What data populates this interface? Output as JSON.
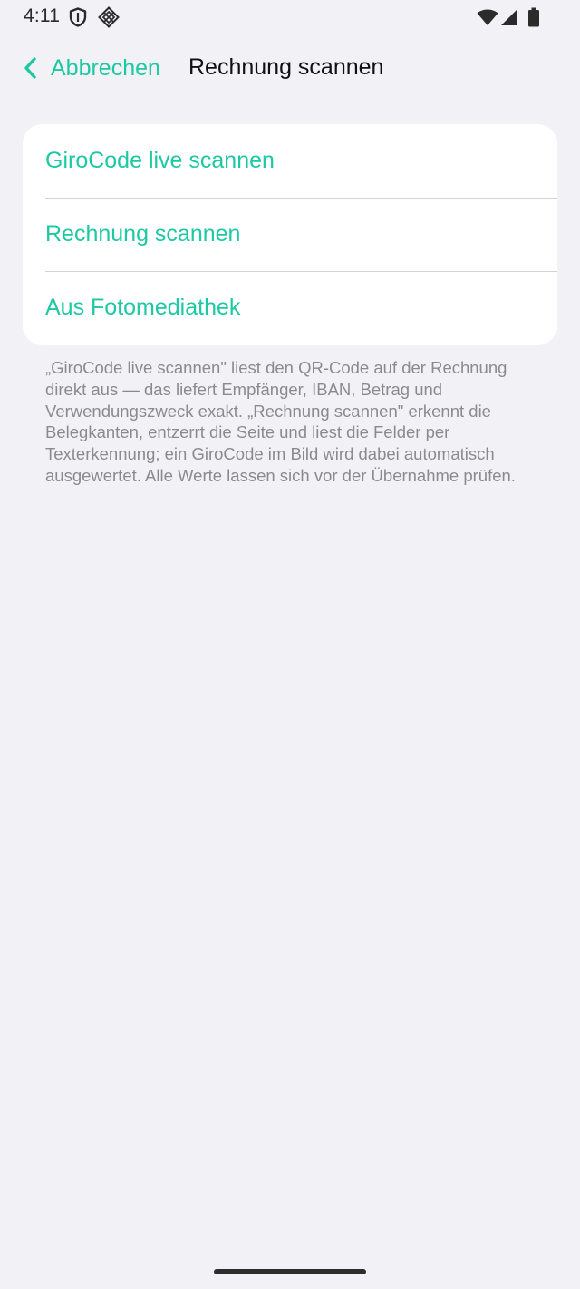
{
  "status_bar": {
    "time": "4:11",
    "icons": [
      "shield-icon",
      "diamond-grid-icon",
      "wifi-icon",
      "cell-signal-icon",
      "battery-icon"
    ]
  },
  "nav": {
    "back_label": "Abbrechen",
    "title": "Rechnung scannen",
    "back_icon": "chevron-left-icon"
  },
  "options": [
    {
      "label": "GiroCode live scannen"
    },
    {
      "label": "Rechnung scannen"
    },
    {
      "label": "Aus Fotomediathek"
    }
  ],
  "description": "„GiroCode live scannen\" liest den QR-Code auf der Rechnung direkt aus — das liefert Empfänger, IBAN, Betrag und Verwendungszweck exakt. „Rechnung scannen\" erkennt die Belegkanten, entzerrt die Seite und liest die Felder per Texterkennung; ein GiroCode im Bild wird dabei automatisch ausgewertet. Alle Werte lassen sich vor der Übernahme prüfen.",
  "colors": {
    "accent": "#1dc9a3",
    "background": "#f2f1f6",
    "card": "#ffffff",
    "secondary_text": "#8b8b8f"
  }
}
